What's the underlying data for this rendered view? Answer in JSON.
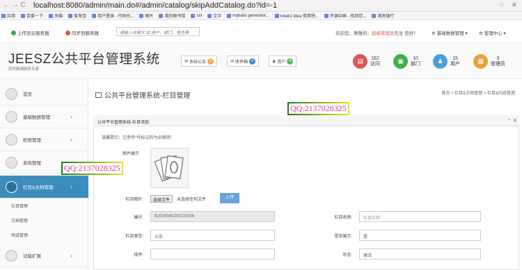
{
  "browser": {
    "nav_glyph": "← → C",
    "url": "localhost:8080/admin/main.do#/admin/catalog/skipAddCatalog.do?id=-1",
    "star": "☆",
    "menu": "≡",
    "bookmarks": [
      "应用",
      "百度一下",
      "天猫",
      "爱淘宝",
      "用户登录 - 代码托...",
      "图片",
      "我的图书馆",
      "sxt",
      "文字",
      "mybatis generator...",
      "IntelliJ Idea 常用快...",
      "开源中国 - 找到您...",
      "浦发银行"
    ]
  },
  "toolbar": {
    "upload_to_server": "上传到云服务器",
    "sync_server": "同步到服务器",
    "search_placeholder": "请输入关键字 如:用户、部门、角色等",
    "welcome_prefix": "欢迎您，尊敬的：",
    "username": "超级管理员",
    "welcome_suffix": "先生  您好！",
    "basic_settings": "基础数据管理",
    "admin_center": "管理中心"
  },
  "header": {
    "logo": "JEESZ公共平台管理系统",
    "slogan": "您的精通服务专家",
    "btn_announce": "系统公告",
    "badge_announce": "1",
    "btn_inbox": "收件箱",
    "badge_inbox": "0",
    "btn_users": "用户",
    "badge_users": "4",
    "stats": [
      {
        "num": "162",
        "label": "访问",
        "color": "#e05555"
      },
      {
        "num": "10",
        "label": "部门",
        "color": "#3fae49"
      },
      {
        "num": "15",
        "label": "用户",
        "color": "#4a9fd6"
      },
      {
        "num": "3",
        "label": "管理员",
        "color": "#e8a23a"
      }
    ]
  },
  "sidebar": {
    "items": [
      "首页",
      "基础数据管理",
      "权限管理",
      "系统管理",
      "栏目&文档管理",
      "功能扩展"
    ],
    "sub_items": [
      "栏目管理",
      "文档管理",
      "频道管理"
    ]
  },
  "main": {
    "page_title": "公共平台管理系统-栏目管理",
    "breadcrumb": "首页 > 栏目&文档管理 > 栏目&内容管理",
    "panel_title": "公共平台管理系统-栏目添加",
    "notice": "温馨提示：注意有*号标记的为必填项！",
    "image_preview_label": "图片展示",
    "column_image_label": "栏目图片:",
    "choose_file": "选择文件",
    "no_file": "未选择任何文件",
    "upload": "上传",
    "code_label": "编号:",
    "code_value": "B2016040200220006",
    "name_label": "栏目名称:",
    "name_placeholder": "栏目名称",
    "type_label": "栏目类型:",
    "type_value": "公告",
    "show_label": "是否展示:",
    "show_value": "是",
    "order_label": "排序:",
    "status_label": "状态:",
    "status_value": "激活"
  },
  "watermark": "QQ:2137028325"
}
